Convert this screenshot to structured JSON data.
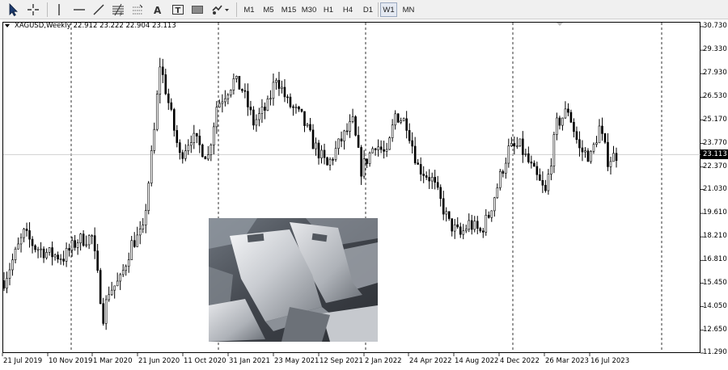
{
  "toolbar": {
    "tools": [
      "cursor-icon",
      "crosshair-icon",
      "vertical-line-icon",
      "horizontal-line-icon",
      "trendline-icon",
      "fibonacci-icon",
      "channel-icon",
      "text-icon",
      "text-label-icon",
      "rectangle-icon",
      "shapes-icon"
    ],
    "timeframes": [
      "M1",
      "M5",
      "M15",
      "M30",
      "H1",
      "H4",
      "D1",
      "W1",
      "MN"
    ],
    "active_timeframe": "W1"
  },
  "chart": {
    "symbol": "XAGUSD,Weekly",
    "ohlc": "22.912 23.222 22.904 23.113",
    "current_price": "23.113",
    "price_labels": [
      "30.730",
      "29.330",
      "27.930",
      "26.530",
      "25.170",
      "23.770",
      "22.370",
      "21.030",
      "19.610",
      "18.210",
      "16.810",
      "15.450",
      "14.050",
      "12.650",
      "11.290"
    ],
    "date_labels": [
      "21 Jul 2019",
      "10 Nov 2019",
      "1 Mar 2020",
      "21 Jun 2020",
      "11 Oct 2020",
      "31 Jan 2021",
      "23 May 2021",
      "12 Sep 2021",
      "2 Jan 2022",
      "24 Apr 2022",
      "14 Aug 2022",
      "4 Dec 2022",
      "26 Mar 2023",
      "16 Jul 2023"
    ],
    "colors": {
      "candle": "#000000",
      "background": "#ffffff",
      "grid_separator": "#000000"
    }
  },
  "chart_data": {
    "type": "candlestick",
    "symbol": "XAGUSD",
    "timeframe": "Weekly",
    "ylim": [
      11.29,
      30.73
    ],
    "x_start": "2019-07-14",
    "x_end": "2023-09-03",
    "close_path": [
      [
        "2019-07-14",
        15.6
      ],
      [
        "2019-08-04",
        16.8
      ],
      [
        "2019-09-01",
        18.4
      ],
      [
        "2019-09-29",
        17.6
      ],
      [
        "2019-11-03",
        17.2
      ],
      [
        "2019-12-08",
        17.0
      ],
      [
        "2020-01-12",
        18.0
      ],
      [
        "2020-02-16",
        18.2
      ],
      [
        "2020-03-15",
        13.5
      ],
      [
        "2020-03-29",
        15.0
      ],
      [
        "2020-04-26",
        15.6
      ],
      [
        "2020-05-24",
        17.8
      ],
      [
        "2020-06-21",
        18.5
      ],
      [
        "2020-07-19",
        24.5
      ],
      [
        "2020-08-02",
        28.5
      ],
      [
        "2020-08-16",
        27.0
      ],
      [
        "2020-09-20",
        23.0
      ],
      [
        "2020-10-18",
        24.2
      ],
      [
        "2020-11-29",
        23.0
      ],
      [
        "2020-12-20",
        26.0
      ],
      [
        "2021-01-31",
        27.5
      ],
      [
        "2021-02-21",
        27.0
      ],
      [
        "2021-03-21",
        25.0
      ],
      [
        "2021-04-25",
        26.0
      ],
      [
        "2021-05-16",
        27.8
      ],
      [
        "2021-06-13",
        26.2
      ],
      [
        "2021-07-18",
        25.3
      ],
      [
        "2021-08-15",
        23.8
      ],
      [
        "2021-09-19",
        22.4
      ],
      [
        "2021-10-24",
        24.0
      ],
      [
        "2021-11-21",
        25.0
      ],
      [
        "2021-12-12",
        22.2
      ],
      [
        "2022-01-16",
        23.8
      ],
      [
        "2022-02-13",
        23.0
      ],
      [
        "2022-03-06",
        25.5
      ],
      [
        "2022-04-03",
        25.0
      ],
      [
        "2022-05-01",
        22.4
      ],
      [
        "2022-06-05",
        21.6
      ],
      [
        "2022-07-17",
        19.0
      ],
      [
        "2022-08-14",
        18.3
      ],
      [
        "2022-09-04",
        19.0
      ],
      [
        "2022-10-02",
        18.5
      ],
      [
        "2022-10-23",
        19.5
      ],
      [
        "2022-11-20",
        21.8
      ],
      [
        "2022-12-11",
        23.4
      ],
      [
        "2023-01-08",
        23.6
      ],
      [
        "2023-02-12",
        22.0
      ],
      [
        "2023-03-12",
        20.8
      ],
      [
        "2023-04-09",
        24.9
      ],
      [
        "2023-05-07",
        25.8
      ],
      [
        "2023-06-04",
        23.4
      ],
      [
        "2023-07-02",
        23.0
      ],
      [
        "2023-07-23",
        24.7
      ],
      [
        "2023-08-13",
        22.8
      ],
      [
        "2023-09-03",
        23.1
      ]
    ]
  }
}
